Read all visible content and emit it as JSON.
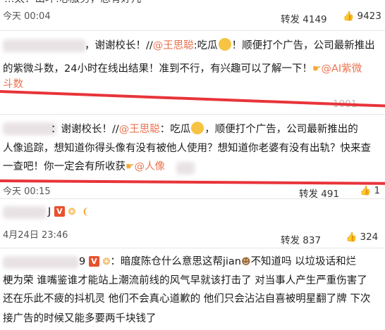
{
  "top": {
    "partial_text": "…太：山坏!心服务，总有好几",
    "time": "今天 00:04",
    "repost": "转发 4149",
    "like": "9423"
  },
  "c1": {
    "l1_a": "，谢谢校长！//",
    "l1_link": "@王思聪",
    "l1_b": ":吃瓜",
    "l1_c": "！顺便打个广告，公司最新推出",
    "l2_a": "的紫微斗数，24小时在线出结果！准到不行，有兴趣可以了解一下！",
    "l2_link": "@AI紫微",
    "l3_link": "斗数",
    "faint_right": "1001"
  },
  "c2": {
    "l1_a": "：谢谢校长！//",
    "l1_link": "@王思聪",
    "l1_b": "：吃瓜",
    "l1_c": "，顺便打个广告，公司最新推出的",
    "l2": "人像追踪，想知道你得头像有没有被他人使用？想知道你老婆有没有出轨？快来查",
    "l3_a": "一查吧！你一定会有所收获",
    "l3_link": "@人像",
    "time": "今天 00:15",
    "repost": "转发 491",
    "like": "1"
  },
  "c3": {
    "name_fragment": "J",
    "date": "4月24日 23:46",
    "repost": "转发 837",
    "like": "324"
  },
  "c4": {
    "name_fragment": "9",
    "l1_a": "：暗度陈仓什么意思这帮jian",
    "l1_b": "不知道吗 以垃圾话和烂",
    "l2": "梗为荣 谁嘴鉴谁才能站上潮流前线的风气早就该打击了 对当事人产生严重伤害了",
    "l3": "还在乐此不疲的抖机灵 他们不会真心道歉的 他们只会沾沾自喜被明星翻了牌 下次",
    "l4": "接广告的时候又能多要两千块钱了"
  },
  "icons": {
    "repost": "repost-icon",
    "like": "thumbs-up-icon",
    "hand": "pointing-hand-icon",
    "vip": "v-badge-icon",
    "emoji": "eating-melon-emoji"
  },
  "colors": {
    "accent": "#eb7350",
    "highlight": "#e8343a"
  }
}
